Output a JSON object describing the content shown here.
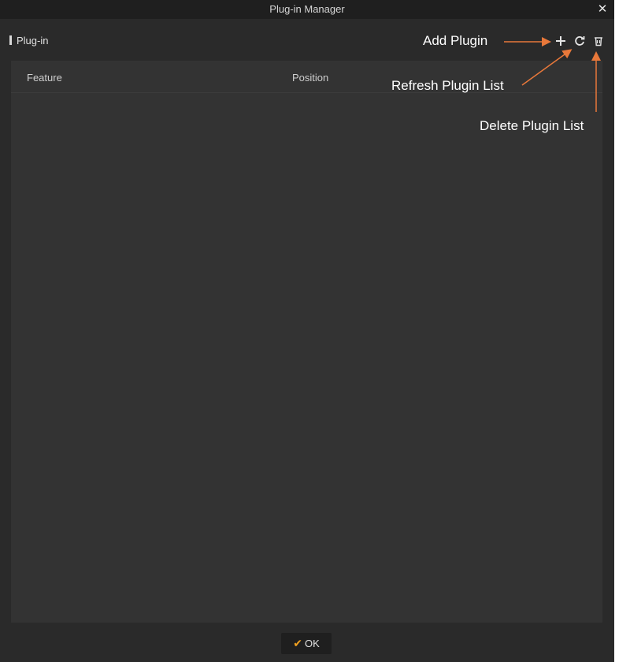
{
  "window": {
    "title": "Plug-in Manager",
    "close_glyph": "✕"
  },
  "section": {
    "title": "Plug-in"
  },
  "toolbar": {
    "add_icon": "plus-icon",
    "refresh_icon": "refresh-icon",
    "delete_icon": "trash-icon"
  },
  "table": {
    "columns": [
      "Feature",
      "Position"
    ],
    "rows": []
  },
  "footer": {
    "ok_check": "✔",
    "ok_label": "OK"
  },
  "annotations": {
    "add": "Add Plugin",
    "refresh": "Refresh Plugin List",
    "delete": "Delete Plugin List",
    "arrow_color": "#e8783a"
  },
  "colors": {
    "window_bg": "#2a2a2a",
    "panel_bg": "#333333",
    "titlebar_bg": "#1f1f1f",
    "accent_check": "#f0a020"
  }
}
